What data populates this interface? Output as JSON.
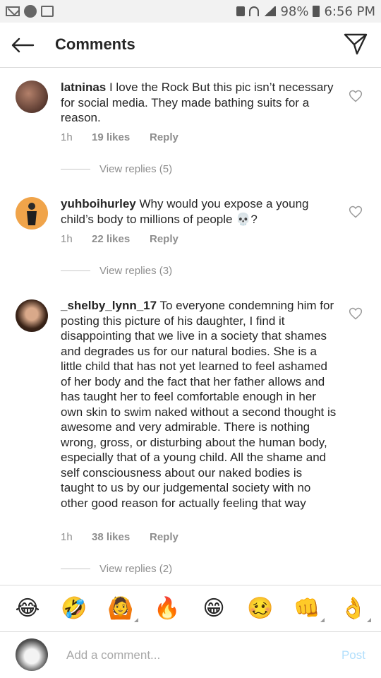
{
  "status_bar": {
    "battery": "98%",
    "time": "6:56 PM",
    "icons": [
      "mail-icon",
      "whatsapp-icon",
      "image-icon",
      "lock-icon",
      "wifi-icon",
      "signal-icon",
      "battery-icon"
    ]
  },
  "header": {
    "title": "Comments",
    "back_icon": "arrow-left-icon",
    "send_icon": "paper-plane-icon"
  },
  "comments": [
    {
      "username": "latninas",
      "text": "I love the Rock But this pic isn’t necessary for social media. They made bathing suits for a reason.",
      "time": "1h",
      "likes": "19 likes",
      "reply": "Reply",
      "view_replies": "View replies (5)"
    },
    {
      "username": "yuhboihurley",
      "text": "Why would you expose a young child’s body to millions of people 💀?",
      "time": "1h",
      "likes": "22 likes",
      "reply": "Reply",
      "view_replies": "View replies (3)"
    },
    {
      "username": "_shelby_lynn_17",
      "text": "To everyone condemning him for posting this picture of his daughter, I find it disappointing that we live in a society that shames and degrades us for our natural bodies. She is a little child that has not yet learned to feel ashamed of her body and the fact that her father allows and has taught her to feel comfortable enough in her own skin to swim naked without a second thought is awesome and very admirable. There is nothing wrong, gross, or disturbing about the human body, especially that of a young child. All the shame and self consciousness about our naked bodies is taught to us by our judgemental society with no other good reason for actually feeling that way",
      "time": "1h",
      "likes": "38 likes",
      "reply": "Reply",
      "view_replies": "View replies (2)"
    }
  ],
  "emoji_bar": [
    "😂",
    "🤣",
    "🙆",
    "🔥",
    "😁",
    "🥴",
    "👊",
    "👌"
  ],
  "input": {
    "placeholder": "Add a comment...",
    "post_label": "Post"
  },
  "colors": {
    "text": "#262626",
    "muted": "#8e8e8e",
    "divider": "#dbdbdb",
    "post_disabled": "#b2dffc"
  }
}
